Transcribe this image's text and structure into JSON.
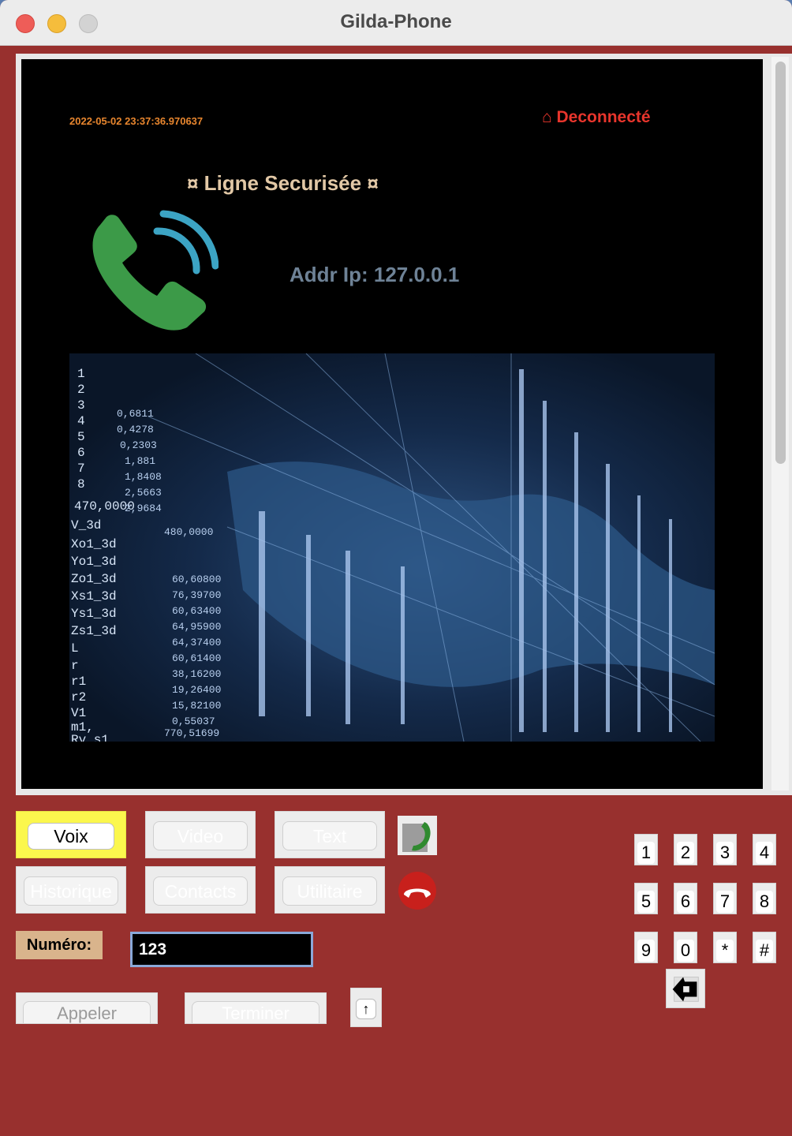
{
  "window": {
    "title": "Gilda-Phone"
  },
  "screen": {
    "timestamp": "2022-05-02 23:37:36.970637",
    "status": "⌂ Deconnecté",
    "line_title": "¤ Ligne Securisée ¤",
    "addr": "Addr Ip: 127.0.0.1",
    "call_icon": "phone-ringing-icon",
    "background_image": "data-matrix-world-map"
  },
  "modes": {
    "voix": "Voix",
    "video": "Video",
    "text": "Text",
    "historique": "Historique",
    "contacts": "Contacts",
    "utilitaire": "Utilitaire",
    "active": "Voix"
  },
  "side_icons": [
    "call-answer-icon",
    "hang-up-icon"
  ],
  "number": {
    "label": "Numéro:",
    "value": "123"
  },
  "actions": {
    "call": "Appeler",
    "end": "Terminer",
    "up": "↑"
  },
  "keypad": [
    "1",
    "2",
    "3",
    "4",
    "5",
    "6",
    "7",
    "8",
    "9",
    "0",
    "*",
    "#"
  ],
  "keypad_back_icon": "backspace-icon",
  "colors": {
    "window_bg": "#98302e",
    "active_mode": "#fbf74d",
    "status": "#e8352c",
    "timestamp": "#e8862e"
  }
}
